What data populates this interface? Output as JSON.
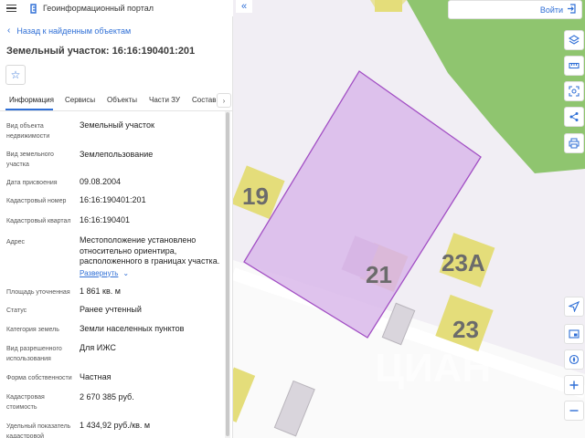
{
  "header": {
    "portal_title": "Геоинформационный портал"
  },
  "panel": {
    "back_label": "Назад к найденным объектам",
    "title": "Земельный участок: 16:16:190401:201",
    "tabs": [
      {
        "label": "Информация"
      },
      {
        "label": "Сервисы"
      },
      {
        "label": "Объекты"
      },
      {
        "label": "Части ЗУ"
      },
      {
        "label": "Состав"
      }
    ],
    "rows": [
      {
        "label": "Вид объекта недвижимости",
        "value": "Земельный участок"
      },
      {
        "label": "Вид земельного участка",
        "value": "Землепользование"
      },
      {
        "label": "Дата присвоения",
        "value": "09.08.2004"
      },
      {
        "label": "Кадастровый номер",
        "value": "16:16:190401:201"
      },
      {
        "label": "Кадастровый квартал",
        "value": "16:16:190401"
      },
      {
        "label": "Адрес",
        "value": "Местоположение установлено относительно ориентира, расположенного в границах участка.",
        "more": "Развернуть"
      },
      {
        "label": "Площадь уточненная",
        "value": "1 861 кв. м"
      },
      {
        "label": "Статус",
        "value": "Ранее учтенный"
      },
      {
        "label": "Категория земель",
        "value": "Земли населенных пунктов"
      },
      {
        "label": "Вид разрешенного использования",
        "value": "Для ИЖС"
      },
      {
        "label": "Форма собственности",
        "value": "Частная"
      },
      {
        "label": "Кадастровая стоимость",
        "value": "2 670 385 руб."
      },
      {
        "label": "Удельный показатель кадастровой",
        "value": "1 434,92 руб./кв. м"
      }
    ]
  },
  "map": {
    "login_label": "Войти",
    "house_numbers": [
      "19",
      "21",
      "23А",
      "23"
    ],
    "watermark": "ЦИАН",
    "colors": {
      "background": "#f1eef4",
      "green_area": "#8fc56f",
      "parcel_fill": "#d9b8ea",
      "parcel_stroke": "#a24fc4",
      "building": "#e4dd7a",
      "road": "#ffffff",
      "accent": "#2f6fd6"
    },
    "tools": [
      "layers-icon",
      "ruler-icon",
      "select-area-icon",
      "share-icon",
      "print-icon",
      "locate-icon",
      "minimap-icon",
      "compass-icon",
      "zoom-in-icon",
      "zoom-out-icon"
    ]
  }
}
